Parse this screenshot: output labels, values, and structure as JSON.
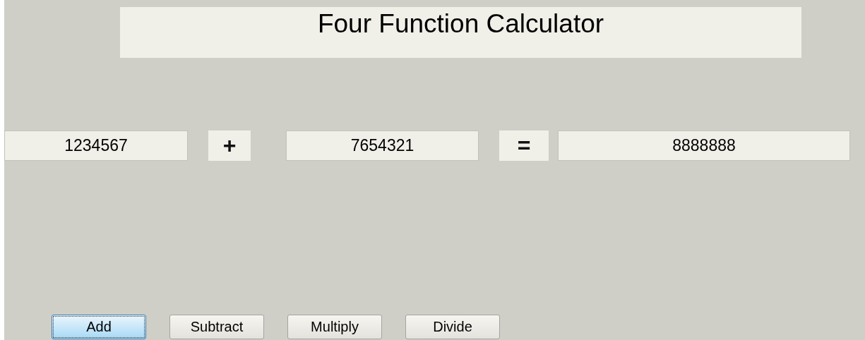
{
  "title": "Four Function Calculator",
  "operand_1": "1234567",
  "operator": "+",
  "operand_2": "7654321",
  "equals": "=",
  "result": "8888888",
  "buttons": [
    {
      "label": "Add",
      "selected": true
    },
    {
      "label": "Subtract",
      "selected": false
    },
    {
      "label": "Multiply",
      "selected": false
    },
    {
      "label": "Divide",
      "selected": false
    }
  ]
}
